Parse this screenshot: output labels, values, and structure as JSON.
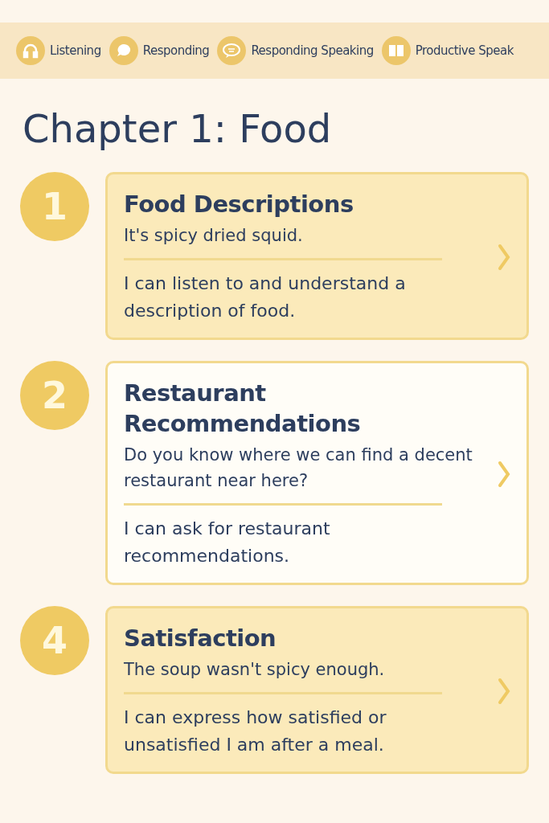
{
  "skill_bar": [
    {
      "kind": "headphones",
      "label": "Listening"
    },
    {
      "kind": "bubble",
      "label": "Responding"
    },
    {
      "kind": "speech",
      "label": "Responding Speaking"
    },
    {
      "kind": "book",
      "label": "Productive Speak"
    }
  ],
  "chapter_title": "Chapter 1: Food",
  "lessons": [
    {
      "number": "1",
      "title": "Food Descriptions",
      "example": "It's spicy dried squid.",
      "goal": "I can listen to and understand a description of food.",
      "highlighted": true
    },
    {
      "number": "2",
      "title": "Restaurant Recommendations",
      "example": "Do you know where we can find a decent restaurant near here?",
      "goal": "I can ask for restaurant recommendations.",
      "highlighted": false
    },
    {
      "number": "4",
      "title": "Satisfaction",
      "example": "The soup wasn't spicy enough.",
      "goal": "I can express how satisfied or unsatisfied I am after a meal.",
      "highlighted": true
    }
  ]
}
